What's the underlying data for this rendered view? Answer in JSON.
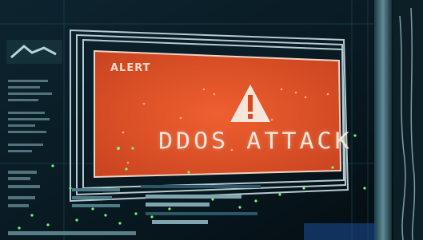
{
  "alert": {
    "label": "ALERT",
    "headline": "DDOS ATTACK",
    "symbol": "warning-triangle-icon"
  },
  "colors": {
    "panel": "#e0532a",
    "frame": "#c9dde4",
    "background": "#07141a",
    "dots": "#6cff7a"
  }
}
